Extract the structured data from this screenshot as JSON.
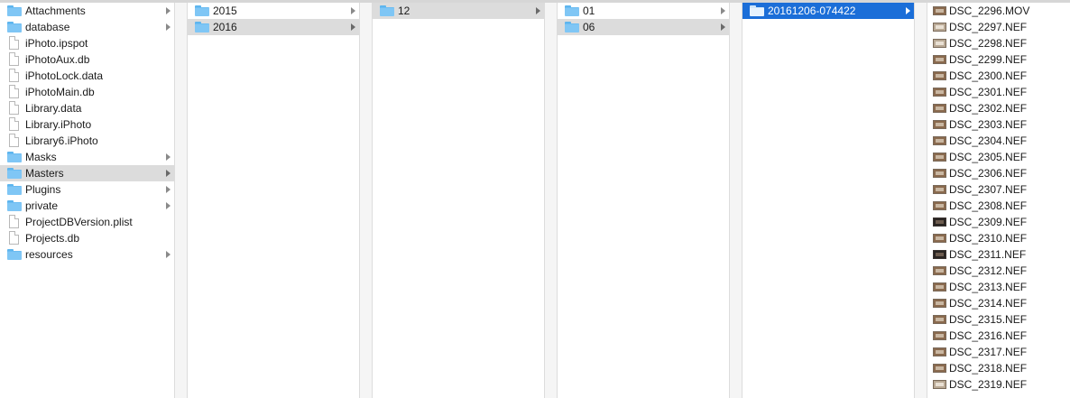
{
  "columns": [
    {
      "items": [
        {
          "label": "Attachments",
          "icon": "folder-icon",
          "arrow": true,
          "state": "none"
        },
        {
          "label": "database",
          "icon": "folder-icon",
          "arrow": true,
          "state": "none"
        },
        {
          "label": "iPhoto.ipspot",
          "icon": "document-icon",
          "arrow": false,
          "state": "none"
        },
        {
          "label": "iPhotoAux.db",
          "icon": "document-icon",
          "arrow": false,
          "state": "none"
        },
        {
          "label": "iPhotoLock.data",
          "icon": "document-icon",
          "arrow": false,
          "state": "none"
        },
        {
          "label": "iPhotoMain.db",
          "icon": "document-icon",
          "arrow": false,
          "state": "none"
        },
        {
          "label": "Library.data",
          "icon": "document-icon",
          "arrow": false,
          "state": "none"
        },
        {
          "label": "Library.iPhoto",
          "icon": "document-icon",
          "arrow": false,
          "state": "none"
        },
        {
          "label": "Library6.iPhoto",
          "icon": "document-icon",
          "arrow": false,
          "state": "none"
        },
        {
          "label": "Masks",
          "icon": "folder-icon",
          "arrow": true,
          "state": "none"
        },
        {
          "label": "Masters",
          "icon": "folder-icon",
          "arrow": true,
          "state": "gray"
        },
        {
          "label": "Plugins",
          "icon": "folder-icon",
          "arrow": true,
          "state": "none"
        },
        {
          "label": "private",
          "icon": "folder-icon",
          "arrow": true,
          "state": "none"
        },
        {
          "label": "ProjectDBVersion.plist",
          "icon": "document-icon",
          "arrow": false,
          "state": "none"
        },
        {
          "label": "Projects.db",
          "icon": "document-icon",
          "arrow": false,
          "state": "none"
        },
        {
          "label": "resources",
          "icon": "folder-icon",
          "arrow": true,
          "state": "none"
        }
      ]
    },
    {
      "items": [
        {
          "label": "2015",
          "icon": "folder-icon",
          "arrow": true,
          "state": "none"
        },
        {
          "label": "2016",
          "icon": "folder-icon",
          "arrow": true,
          "state": "gray"
        }
      ]
    },
    {
      "items": [
        {
          "label": "12",
          "icon": "folder-icon",
          "arrow": true,
          "state": "gray"
        }
      ]
    },
    {
      "items": [
        {
          "label": "01",
          "icon": "folder-icon",
          "arrow": true,
          "state": "none"
        },
        {
          "label": "06",
          "icon": "folder-icon",
          "arrow": true,
          "state": "gray"
        }
      ]
    },
    {
      "items": [
        {
          "label": "20161206-074422",
          "icon": "folder-icon",
          "arrow": true,
          "state": "blue"
        }
      ]
    }
  ],
  "files": [
    {
      "label": "DSC_2296.MOV",
      "icon": "video-thumbnail-icon",
      "tone": "mid"
    },
    {
      "label": "DSC_2297.NEF",
      "icon": "image-thumbnail-icon",
      "tone": "light"
    },
    {
      "label": "DSC_2298.NEF",
      "icon": "image-thumbnail-icon",
      "tone": "light"
    },
    {
      "label": "DSC_2299.NEF",
      "icon": "image-thumbnail-icon",
      "tone": "mid"
    },
    {
      "label": "DSC_2300.NEF",
      "icon": "image-thumbnail-icon",
      "tone": "mid"
    },
    {
      "label": "DSC_2301.NEF",
      "icon": "image-thumbnail-icon",
      "tone": "mid"
    },
    {
      "label": "DSC_2302.NEF",
      "icon": "image-thumbnail-icon",
      "tone": "mid"
    },
    {
      "label": "DSC_2303.NEF",
      "icon": "image-thumbnail-icon",
      "tone": "mid"
    },
    {
      "label": "DSC_2304.NEF",
      "icon": "image-thumbnail-icon",
      "tone": "mid"
    },
    {
      "label": "DSC_2305.NEF",
      "icon": "image-thumbnail-icon",
      "tone": "mid"
    },
    {
      "label": "DSC_2306.NEF",
      "icon": "image-thumbnail-icon",
      "tone": "mid"
    },
    {
      "label": "DSC_2307.NEF",
      "icon": "image-thumbnail-icon",
      "tone": "mid"
    },
    {
      "label": "DSC_2308.NEF",
      "icon": "image-thumbnail-icon",
      "tone": "mid"
    },
    {
      "label": "DSC_2309.NEF",
      "icon": "image-thumbnail-icon",
      "tone": "dark"
    },
    {
      "label": "DSC_2310.NEF",
      "icon": "image-thumbnail-icon",
      "tone": "mid"
    },
    {
      "label": "DSC_2311.NEF",
      "icon": "image-thumbnail-icon",
      "tone": "dark"
    },
    {
      "label": "DSC_2312.NEF",
      "icon": "image-thumbnail-icon",
      "tone": "mid"
    },
    {
      "label": "DSC_2313.NEF",
      "icon": "image-thumbnail-icon",
      "tone": "mid"
    },
    {
      "label": "DSC_2314.NEF",
      "icon": "image-thumbnail-icon",
      "tone": "mid"
    },
    {
      "label": "DSC_2315.NEF",
      "icon": "image-thumbnail-icon",
      "tone": "mid"
    },
    {
      "label": "DSC_2316.NEF",
      "icon": "image-thumbnail-icon",
      "tone": "mid"
    },
    {
      "label": "DSC_2317.NEF",
      "icon": "image-thumbnail-icon",
      "tone": "mid"
    },
    {
      "label": "DSC_2318.NEF",
      "icon": "image-thumbnail-icon",
      "tone": "mid"
    },
    {
      "label": "DSC_2319.NEF",
      "icon": "image-thumbnail-icon",
      "tone": "light"
    }
  ],
  "colors": {
    "selection_blue": "#1b6ed8",
    "selection_gray": "#dcdcdc",
    "folder": "#7fc6f5"
  }
}
